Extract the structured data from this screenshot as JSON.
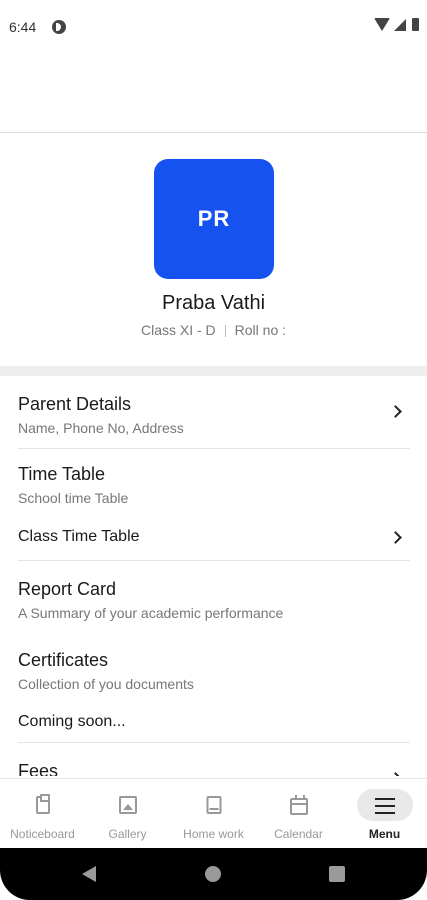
{
  "status_bar": {
    "time": "6:44"
  },
  "profile": {
    "initials": "PR",
    "name": "Praba Vathi",
    "class_info": "Class XI - D",
    "roll_info": "Roll no :",
    "avatar_color": "#1652f0"
  },
  "menu": {
    "parent_details": {
      "title": "Parent Details",
      "subtitle": "Name, Phone No,  Address"
    },
    "time_table": {
      "title": "Time Table",
      "subtitle": "School time Table",
      "sub_item": "Class Time Table"
    },
    "report_card": {
      "title": "Report Card",
      "subtitle": "A Summary of your academic performance"
    },
    "certificates": {
      "title": "Certificates",
      "subtitle": "Collection of you documents",
      "status": "Coming soon..."
    },
    "fees": {
      "title": "Fees"
    }
  },
  "bottom_nav": {
    "items": [
      {
        "label": "Noticeboard",
        "icon": "clipboard-icon"
      },
      {
        "label": "Gallery",
        "icon": "image-icon"
      },
      {
        "label": "Home work",
        "icon": "book-icon"
      },
      {
        "label": "Calendar",
        "icon": "calendar-icon"
      },
      {
        "label": "Menu",
        "icon": "hamburger-icon"
      }
    ],
    "active": "Menu"
  }
}
